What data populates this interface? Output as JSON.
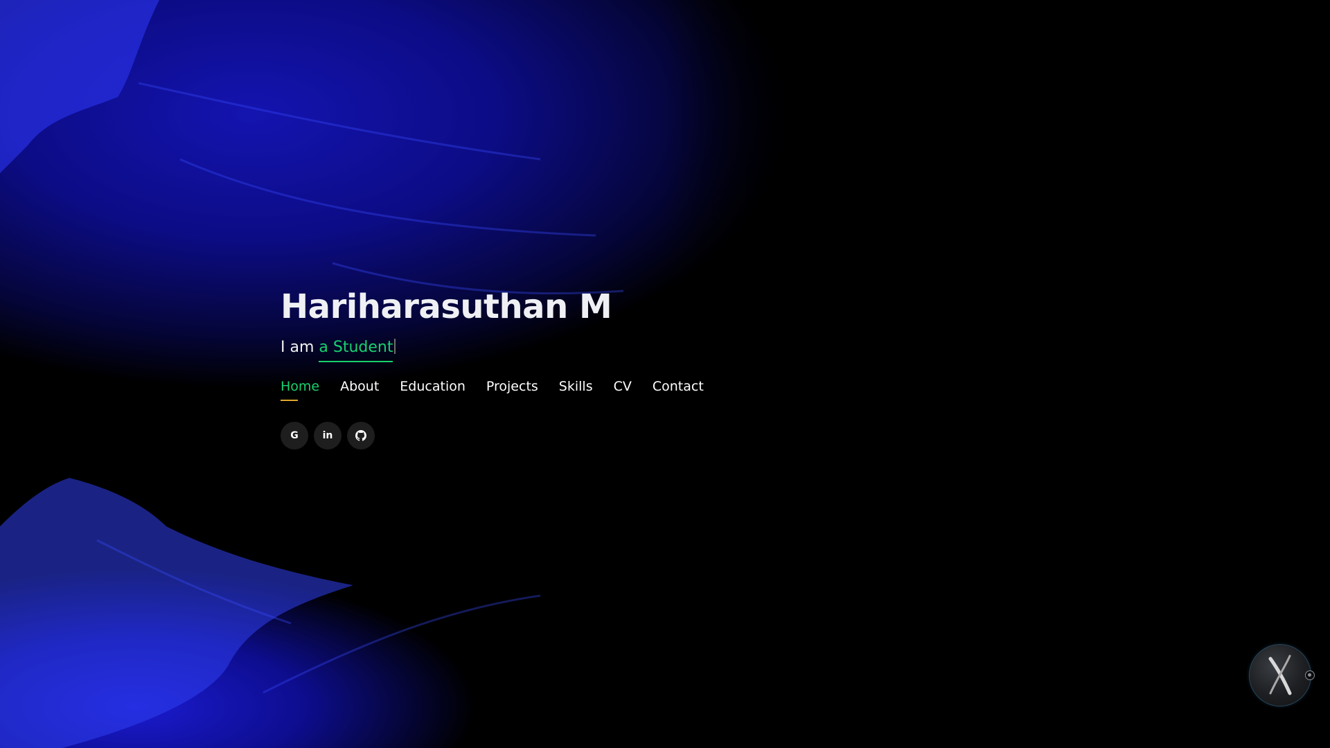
{
  "hero": {
    "name": "Hariharasuthan M",
    "tagline_prefix": "I am",
    "tagline_role": "a Student"
  },
  "nav": {
    "items": [
      {
        "label": "Home",
        "active": true
      },
      {
        "label": "About",
        "active": false
      },
      {
        "label": "Education",
        "active": false
      },
      {
        "label": "Projects",
        "active": false
      },
      {
        "label": "Skills",
        "active": false
      },
      {
        "label": "CV",
        "active": false
      },
      {
        "label": "Contact",
        "active": false
      }
    ]
  },
  "social": {
    "items": [
      {
        "icon": "google-icon",
        "glyph": "G"
      },
      {
        "icon": "linkedin-icon",
        "glyph": "in"
      },
      {
        "icon": "github-icon",
        "glyph": ""
      }
    ]
  },
  "floating_button": {
    "icon": "x-logo-icon"
  },
  "colors": {
    "accent": "#18d26e",
    "nav_underline": "#e0a82e",
    "background": "#000000",
    "paint": "#1a1ad8"
  }
}
